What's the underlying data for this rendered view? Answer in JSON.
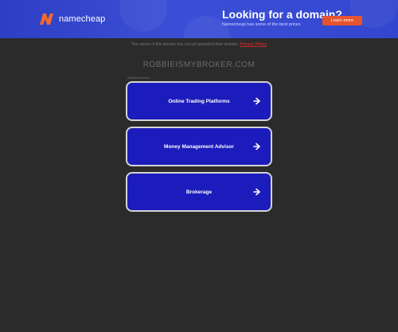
{
  "banner": {
    "logo_text": "namecheap",
    "promo_title": "Looking for a domain?",
    "promo_subtitle": "Namecheap has some of the best prices",
    "learn_more_label": "Learn more"
  },
  "notice": {
    "text": "The owner of this domain has not yet uploaded their website.",
    "privacy_label": "Privacy Policy"
  },
  "domain": "ROBBIEISMYBROKER.COM",
  "related_label": "Related Searches:",
  "links": [
    {
      "label": "Online Trading Platforms"
    },
    {
      "label": "Money Management Advisor"
    },
    {
      "label": "Brokerage"
    }
  ],
  "colors": {
    "banner": "#3346cf",
    "background": "#2b2b2b",
    "card": "#1c1cbc",
    "card_border": "#d4d4d4",
    "accent": "#e6532f"
  }
}
